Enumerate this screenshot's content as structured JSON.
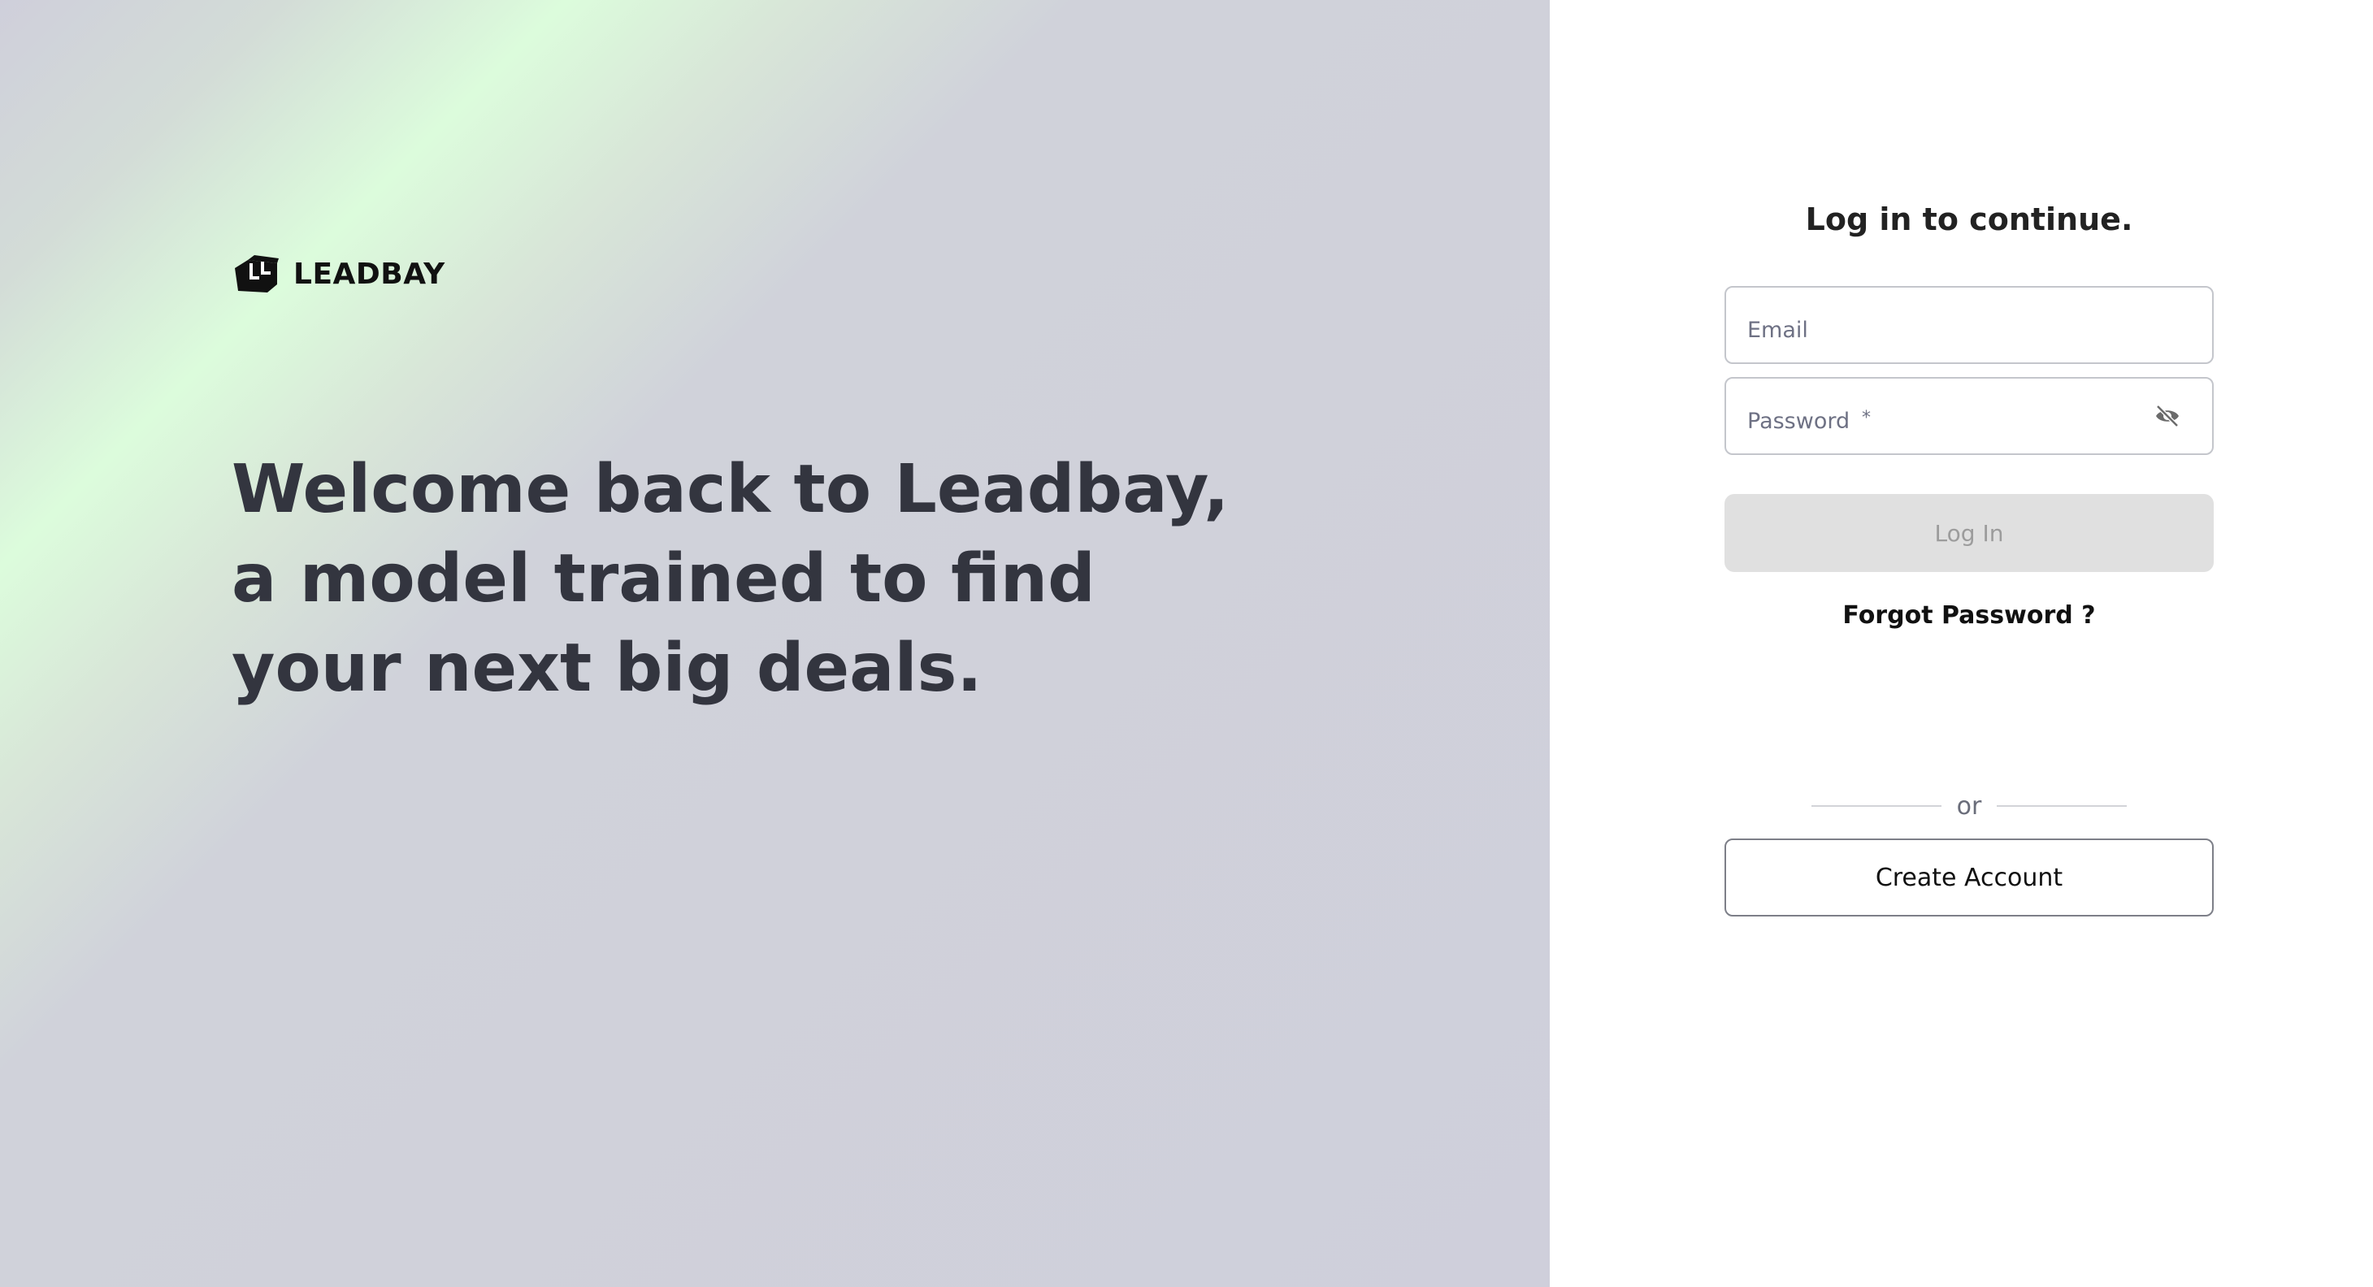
{
  "brand": {
    "name": "LEADBAY",
    "logo_icon": "leadbay-cube-icon"
  },
  "hero": {
    "line1": "Welcome back to Leadbay,",
    "line2": "a model trained to find",
    "line3": "your next big deals."
  },
  "login": {
    "title": "Log in to continue.",
    "email_placeholder": "Email",
    "password_placeholder": "Password",
    "password_required_marker": "*",
    "password_toggle_icon": "eye-off-icon",
    "login_button": "Log In",
    "forgot_password": "Forgot Password ?",
    "divider_text": "or",
    "create_account_button": "Create Account"
  },
  "colors": {
    "accent_green": "#dcfcdc",
    "panel_gray": "#cfcfdb",
    "headline": "#33353f",
    "disabled_button": "#e0e0e0"
  }
}
